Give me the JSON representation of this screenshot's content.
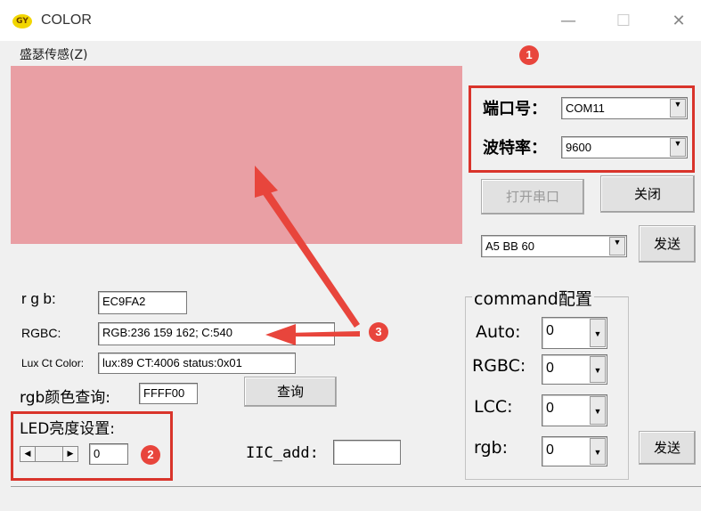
{
  "window": {
    "title": "COLOR",
    "icon_text": "GY",
    "minimize_glyph": "—",
    "maximize_glyph": "☐",
    "close_glyph": "✕"
  },
  "menu": {
    "item": "盛瑟传感(Z)"
  },
  "colors": {
    "preview": "#e99fa4",
    "annotation": "#d9342b",
    "badge": "#e8453c"
  },
  "port": {
    "port_label": "端口号：",
    "port_value": "COM11",
    "baud_label": "波特率：",
    "baud_value": "9600"
  },
  "buttons": {
    "open_port": "打开串口",
    "close": "关闭",
    "send1": "发送",
    "query": "查询",
    "send2": "发送"
  },
  "hex_send": {
    "value": "A5 BB 60"
  },
  "readouts": {
    "rgb_label": "r g b:",
    "rgb_value": "EC9FA2",
    "rgbc_label": "RGBC:",
    "rgbc_value": "RGB:236  159 162;   C:540",
    "lux_label": "Lux Ct Color:",
    "lux_value": "lux:89  CT:4006  status:0x01",
    "query_label": "rgb颜色查询:",
    "query_value": "FFFF00"
  },
  "led": {
    "label": "LED亮度设置:",
    "value": "0",
    "left_arrow": "◀",
    "right_arrow": "▶"
  },
  "iic": {
    "label": "IIC_add:",
    "value": ""
  },
  "command": {
    "title": "command配置",
    "rows": [
      {
        "label": "Auto:",
        "value": "0"
      },
      {
        "label": "RGBC:",
        "value": "0"
      },
      {
        "label": "LCC:",
        "value": "0"
      },
      {
        "label": "rgb:",
        "value": "0"
      }
    ]
  },
  "annotations": {
    "badge1": "1",
    "badge2": "2",
    "badge3": "3"
  },
  "dropdown_glyph": "▼"
}
